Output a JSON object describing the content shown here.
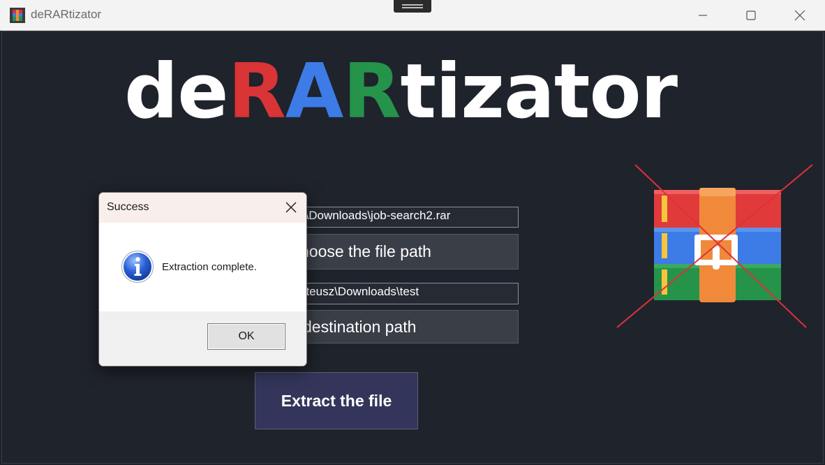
{
  "window": {
    "title": "deRARtizator",
    "icon": "winrar-app-icon"
  },
  "logo": {
    "part1": "de",
    "part2": "R",
    "part3": "A",
    "part4": "R",
    "part5": "tizator",
    "colors": {
      "base": "#ffffff",
      "r1": "#d93436",
      "a": "#3d7be6",
      "r2": "#25934a"
    }
  },
  "source": {
    "path_value": "z\\Downloads\\job-search2.rar",
    "button_label": "hoose the file path"
  },
  "destination": {
    "path_value": "ateusz\\Downloads\\test",
    "button_label": "destination path"
  },
  "extract_button": "Extract the file",
  "dialog": {
    "title": "Success",
    "message": "Extraction complete.",
    "ok_label": "OK",
    "icon": "info-icon"
  },
  "rar_image": {
    "icon": "crossed-out-winrar-logo"
  }
}
